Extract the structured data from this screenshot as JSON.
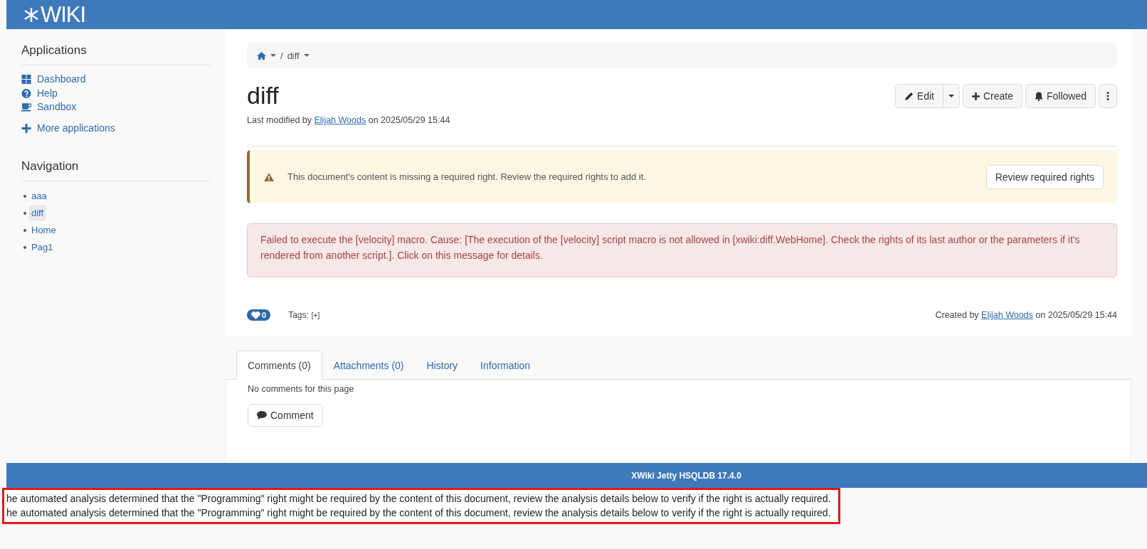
{
  "header": {
    "logo_text": "WIKI"
  },
  "sidebar": {
    "panels": [
      {
        "kind": "apps",
        "title": "Applications",
        "items": [
          {
            "label": "Dashboard"
          },
          {
            "label": "Help"
          },
          {
            "label": "Sandbox"
          }
        ],
        "more": "More applications"
      },
      {
        "kind": "nav",
        "title": "Navigation",
        "items": [
          {
            "label": "aaa",
            "selected": false
          },
          {
            "label": "diff",
            "selected": true
          },
          {
            "label": "Home",
            "selected": false
          },
          {
            "label": "Pag1",
            "selected": false
          }
        ]
      }
    ]
  },
  "main": {
    "breadcrumb": [
      {
        "separator": "/",
        "label": "diff"
      }
    ],
    "title": "diff",
    "last_modified": {
      "prefix": "Last modified by",
      "author": "Elijah Woods",
      "suffix": "on 2025/05/29 15:44"
    },
    "actions": [
      {
        "kind": "edit",
        "label": "Edit"
      },
      {
        "kind": "create",
        "label": "Create"
      },
      {
        "kind": "follow",
        "label": "Followed"
      },
      {
        "kind": "more"
      }
    ],
    "warning": {
      "text": "This document's content is missing a required right. Review the required rights to add it.",
      "button": "Review required rights"
    },
    "error": {
      "text": "Failed to execute the [velocity] macro. Cause: [The execution of the [velocity] script macro is not allowed in [xwiki:diff.WebHome]. Check the rights of its last author or the parameters if it's rendered from another script.]. Click on this message for details."
    },
    "likes": "0",
    "tags": {
      "label": "Tags:",
      "add": "[+]"
    },
    "created": {
      "prefix": "Created by",
      "author": "Elijah Woods",
      "suffix": "on 2025/05/29 15:44"
    },
    "tabs": [
      {
        "label": "Comments (0)",
        "selected": true
      },
      {
        "label": "Attachments (0)",
        "selected": false
      },
      {
        "label": "History",
        "selected": false
      },
      {
        "label": "Information",
        "selected": false
      }
    ],
    "comments": {
      "empty": "No comments for this page",
      "button": "Comment"
    }
  },
  "footer": {
    "text": "XWiki Jetty HSQLDB 17.4.0"
  },
  "notice": {
    "lines": [
      "he automated analysis determined that the \"Programming\" right might be required by the content of this document, review the analysis details below to verify if the right is actually required.",
      "he automated analysis determined that the \"Programming\" right might be required by the content of this document, review the analysis details below to verify if the right is actually required."
    ]
  }
}
